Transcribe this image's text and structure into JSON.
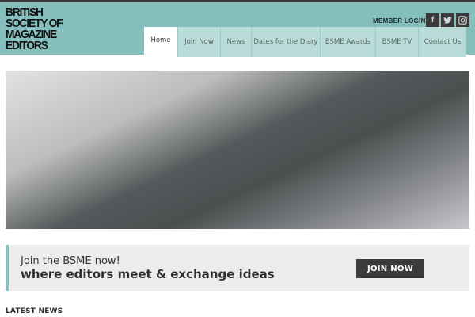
{
  "logo": {
    "lines": [
      "BRITISH",
      "SOCIETY OF",
      "MAGAZINE",
      "EDITORS"
    ]
  },
  "header": {
    "member_login": "MEMBER LOGIN",
    "social": [
      {
        "icon": "facebook-icon",
        "glyph": "f"
      },
      {
        "icon": "twitter-icon",
        "glyph": "t"
      },
      {
        "icon": "instagram-icon",
        "glyph": ""
      }
    ]
  },
  "nav": {
    "items": [
      {
        "label": "Home",
        "active": true
      },
      {
        "label": "Join Now"
      },
      {
        "label": "News"
      },
      {
        "label": "Dates for the Diary"
      },
      {
        "label": "BSME Awards"
      },
      {
        "label": "BSME TV"
      },
      {
        "label": "Contact Us"
      }
    ]
  },
  "join": {
    "line1": "Join the BSME now!",
    "line2": "where editors meet & exchange ideas",
    "button": "JOIN NOW"
  },
  "latest_news": {
    "heading": "LATEST NEWS"
  },
  "colors": {
    "header_bg": "#84bfbd",
    "nav_bg": "#b9dcd9",
    "button_bg": "#3b3b3b"
  }
}
